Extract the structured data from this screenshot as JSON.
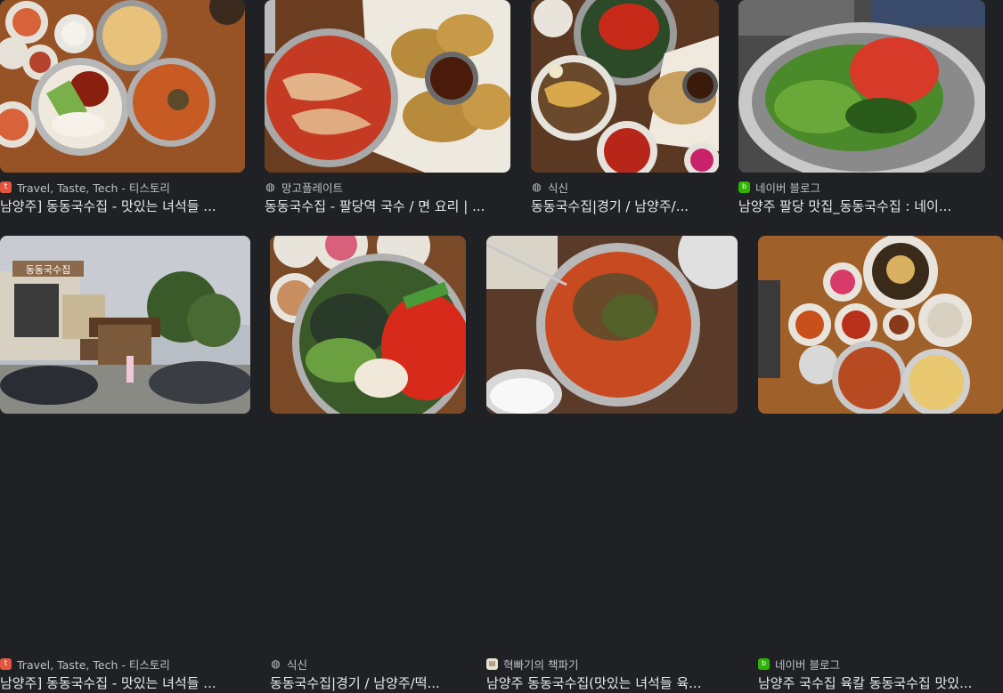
{
  "results": [
    {
      "source": "Travel, Taste, Tech - 티스토리",
      "favicon": "tistory-icon",
      "title": "남양주] 동동국수집 - 맛있는 녀석들 ..."
    },
    {
      "source": "망고플레이트",
      "favicon": "globe-icon",
      "title": "동동국수집 - 팔당역 국수 / 면 요리 | ..."
    },
    {
      "source": "식신",
      "favicon": "globe-icon",
      "title": "동동국수집|경기 / 남양주/..."
    },
    {
      "source": "네이버 블로그",
      "favicon": "naver-blog-icon",
      "title": "남양주 팔당 맛집_동동국수집 : 네이..."
    },
    {
      "source": "Travel, Taste, Tech - 티스토리",
      "favicon": "tistory-icon",
      "title": "남양주] 동동국수집 - 맛있는 녀석들 ..."
    },
    {
      "source": "식신",
      "favicon": "globe-icon",
      "title": "동동국수집|경기 / 남양주/떡..."
    },
    {
      "source": "혁빠기의 책파기",
      "favicon": "blog-book-icon",
      "title": "남양주 동동국수집(맛있는 녀석들 육..."
    },
    {
      "source": "네이버 블로그",
      "favicon": "naver-blog-icon",
      "title": "남양주 국수집 육칼 동동국수집 맛있..."
    }
  ],
  "restaurant_sign": "동동국수집",
  "colors": {
    "background": "#202124",
    "text": "#e8eaed",
    "meta": "#bdc1c6"
  }
}
